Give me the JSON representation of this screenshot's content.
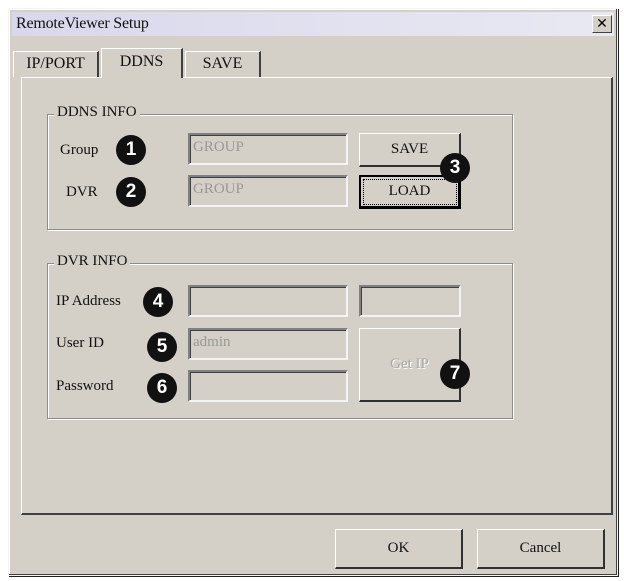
{
  "window": {
    "title": "RemoteViewer Setup",
    "close_symbol": "✕"
  },
  "tabs": [
    {
      "label": "IP/PORT",
      "active": false
    },
    {
      "label": "DDNS",
      "active": true
    },
    {
      "label": "SAVE",
      "active": false
    }
  ],
  "ddns_info": {
    "legend": "DDNS INFO",
    "group_label": "Group",
    "group_value": "GROUP",
    "dvr_label": "DVR",
    "dvr_value": "GROUP",
    "save_button": "SAVE",
    "load_button": "LOAD"
  },
  "dvr_info": {
    "legend": "DVR INFO",
    "ip_label": "IP Address",
    "ip_value": "",
    "port_value": "",
    "userid_label": "User ID",
    "userid_value": "admin",
    "password_label": "Password",
    "password_value": "",
    "getip_button": "Get IP"
  },
  "callouts": [
    "1",
    "2",
    "3",
    "4",
    "5",
    "6",
    "7"
  ],
  "footer": {
    "ok_button": "OK",
    "cancel_button": "Cancel"
  }
}
